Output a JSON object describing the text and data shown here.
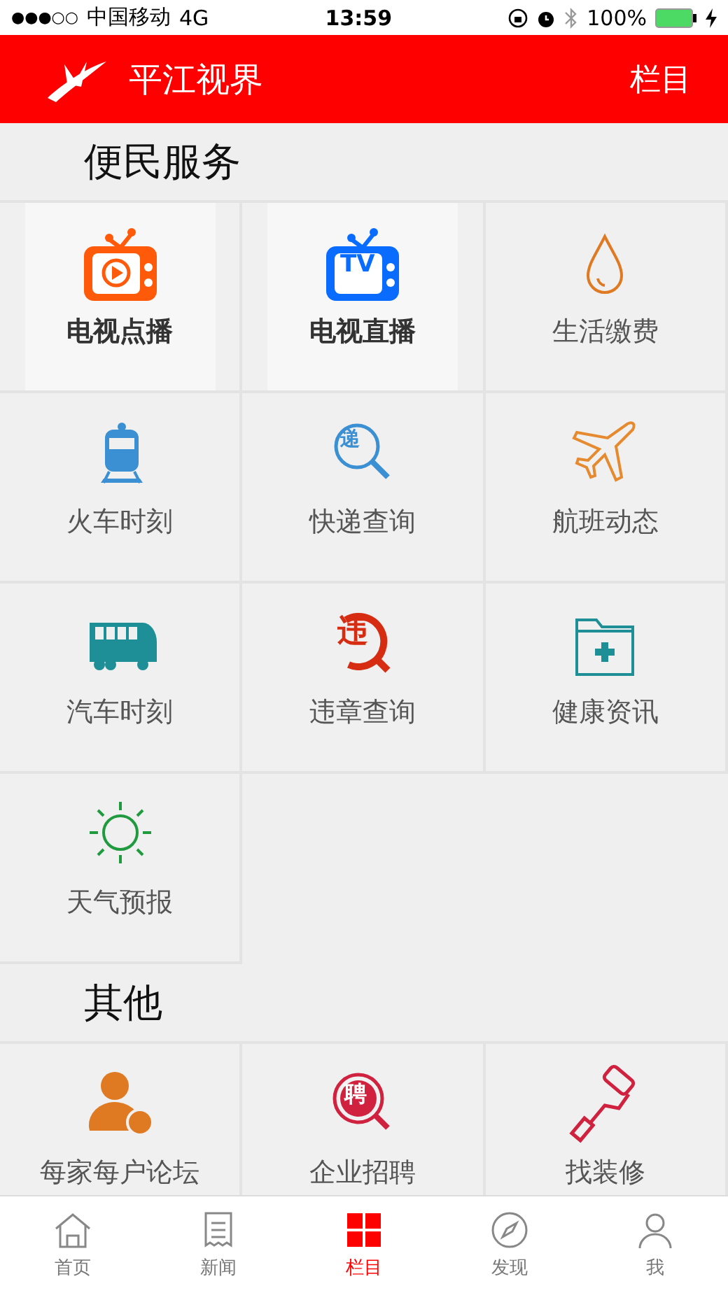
{
  "status_bar": {
    "signal": "●●●○○",
    "carrier": "中国移动",
    "network": "4G",
    "time": "13:59",
    "battery": "100%"
  },
  "header": {
    "title": "平江视界",
    "action": "栏目"
  },
  "sections": [
    {
      "title": "便民服务",
      "items": [
        {
          "label": "电视点播",
          "kind": "tvplay",
          "highlighted": true
        },
        {
          "label": "电视直播",
          "kind": "tv",
          "icon_text": "TV",
          "highlighted": true
        },
        {
          "label": "生活缴费",
          "kind": "drop",
          "highlighted": false
        },
        {
          "label": "火车时刻",
          "kind": "train",
          "highlighted": false
        },
        {
          "label": "快递查询",
          "kind": "courier",
          "icon_text": "递",
          "highlighted": false
        },
        {
          "label": "航班动态",
          "kind": "plane",
          "highlighted": false
        },
        {
          "label": "汽车时刻",
          "kind": "bus",
          "highlighted": false
        },
        {
          "label": "违章查询",
          "kind": "violation",
          "icon_text": "违",
          "highlighted": false
        },
        {
          "label": "健康资讯",
          "kind": "health",
          "highlighted": false
        },
        {
          "label": "天气预报",
          "kind": "sun",
          "highlighted": false
        }
      ]
    },
    {
      "title": "其他",
      "items": [
        {
          "label": "每家每户论坛",
          "kind": "forum",
          "highlighted": false
        },
        {
          "label": "企业招聘",
          "kind": "hire",
          "icon_text": "聘",
          "highlighted": false
        },
        {
          "label": "找装修",
          "kind": "roller",
          "highlighted": false
        }
      ]
    }
  ],
  "tab_bar": [
    {
      "label": "首页",
      "kind": "home",
      "selected": false
    },
    {
      "label": "新闻",
      "kind": "news",
      "selected": false
    },
    {
      "label": "栏目",
      "kind": "grid",
      "selected": true
    },
    {
      "label": "发现",
      "kind": "compass",
      "selected": false
    },
    {
      "label": "我",
      "kind": "person",
      "selected": false
    }
  ]
}
